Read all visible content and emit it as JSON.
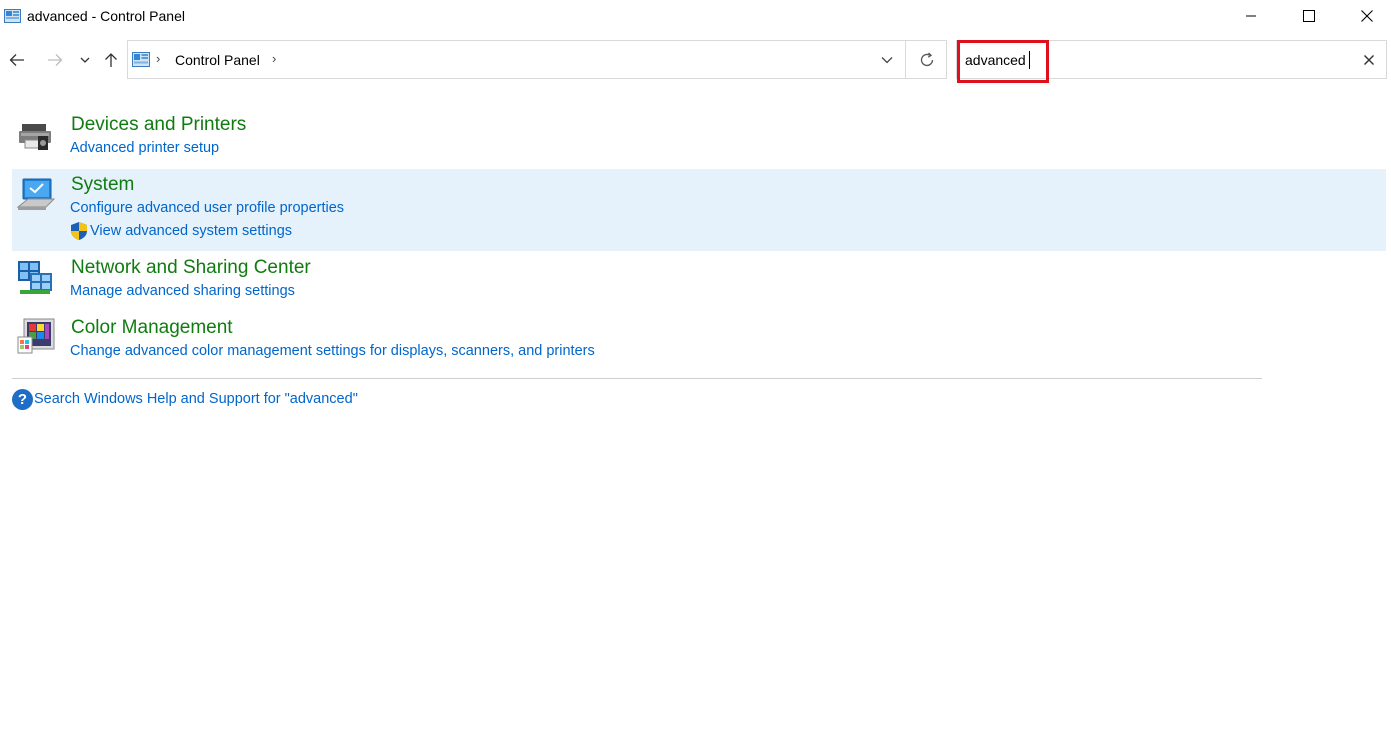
{
  "window": {
    "title": "advanced - Control Panel",
    "icon": "control-panel-icon"
  },
  "nav": {
    "breadcrumb": [
      "Control Panel"
    ]
  },
  "search": {
    "value": "advanced"
  },
  "results": [
    {
      "title": "Devices and Printers",
      "icon": "devices-printers-icon",
      "links": [
        "Advanced printer setup"
      ]
    },
    {
      "title": "System",
      "icon": "system-icon",
      "selected": true,
      "links": [
        "Configure advanced user profile properties",
        "View advanced system settings"
      ],
      "shield_on_link": 1
    },
    {
      "title": "Network and Sharing Center",
      "icon": "network-icon",
      "links": [
        "Manage advanced sharing settings"
      ]
    },
    {
      "title": "Color Management",
      "icon": "color-management-icon",
      "links": [
        "Change advanced color management settings for displays, scanners, and printers"
      ]
    }
  ],
  "help": {
    "label": "Search Windows Help and Support for \"advanced\""
  },
  "colors": {
    "title_green": "#107c10",
    "link_blue": "#0066cc",
    "selected_bg": "#e5f1fb",
    "highlight_red": "#e00f1c"
  }
}
